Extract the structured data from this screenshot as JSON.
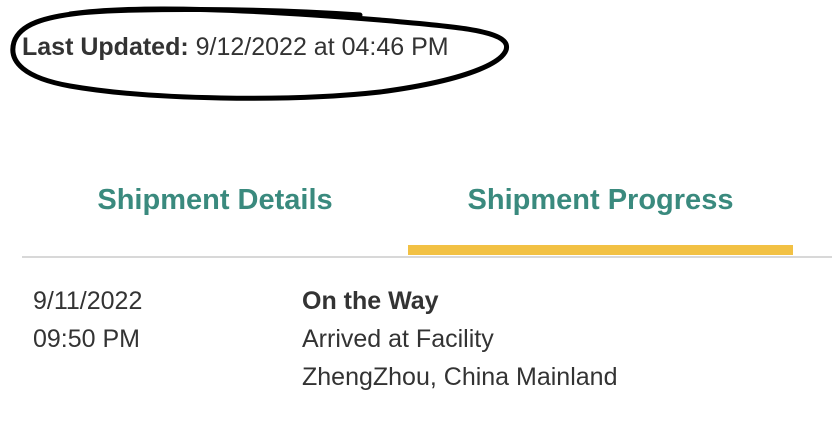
{
  "header": {
    "last_updated_label": "Last Updated:",
    "last_updated_value": "9/12/2022 at 04:46 PM"
  },
  "tabs": [
    {
      "label": "Shipment Details",
      "active": false
    },
    {
      "label": "Shipment Progress",
      "active": true
    }
  ],
  "events": [
    {
      "date": "9/11/2022",
      "time": "09:50 PM",
      "status": "On the Way",
      "description": "Arrived at Facility",
      "location": "ZhengZhou, China Mainland"
    }
  ],
  "colors": {
    "tab_text": "#3a8a7e",
    "active_indicator": "#f2c144",
    "text": "#333333",
    "divider": "#d8d8d8",
    "annotation_ink": "#000000"
  }
}
